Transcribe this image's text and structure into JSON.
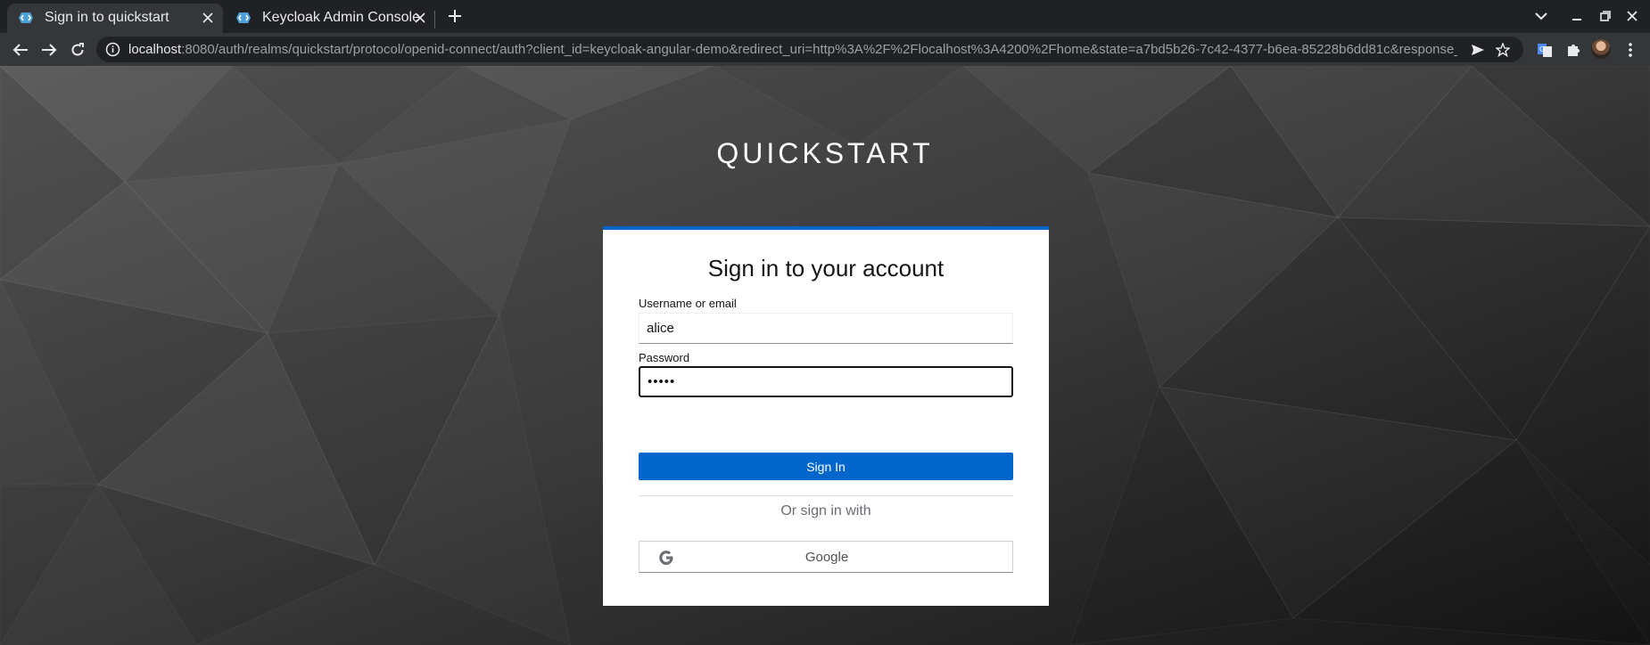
{
  "browser": {
    "tabs": [
      {
        "title": "Sign in to quickstart",
        "active": true,
        "favicon": "keycloak-icon"
      },
      {
        "title": "Keycloak Admin Console",
        "active": false,
        "favicon": "keycloak-icon"
      }
    ],
    "url_host": "localhost",
    "url_rest": ":8080/auth/realms/quickstart/protocol/openid-connect/auth?client_id=keycloak-angular-demo&redirect_uri=http%3A%2F%2Flocalhost%3A4200%2Fhome&state=a7bd5b26-7c42-4377-b6ea-85228b6dd81c&response_mode=f..."
  },
  "page": {
    "realm_name": "QUICKSTART",
    "card_title": "Sign in to your account",
    "username_label": "Username or email",
    "username_value": "alice",
    "password_label": "Password",
    "password_value": "•••••",
    "signin_label": "Sign In",
    "or_text": "Or sign in with",
    "google_label": "Google"
  },
  "colors": {
    "accent": "#0066cc",
    "card_background": "#ffffff"
  }
}
